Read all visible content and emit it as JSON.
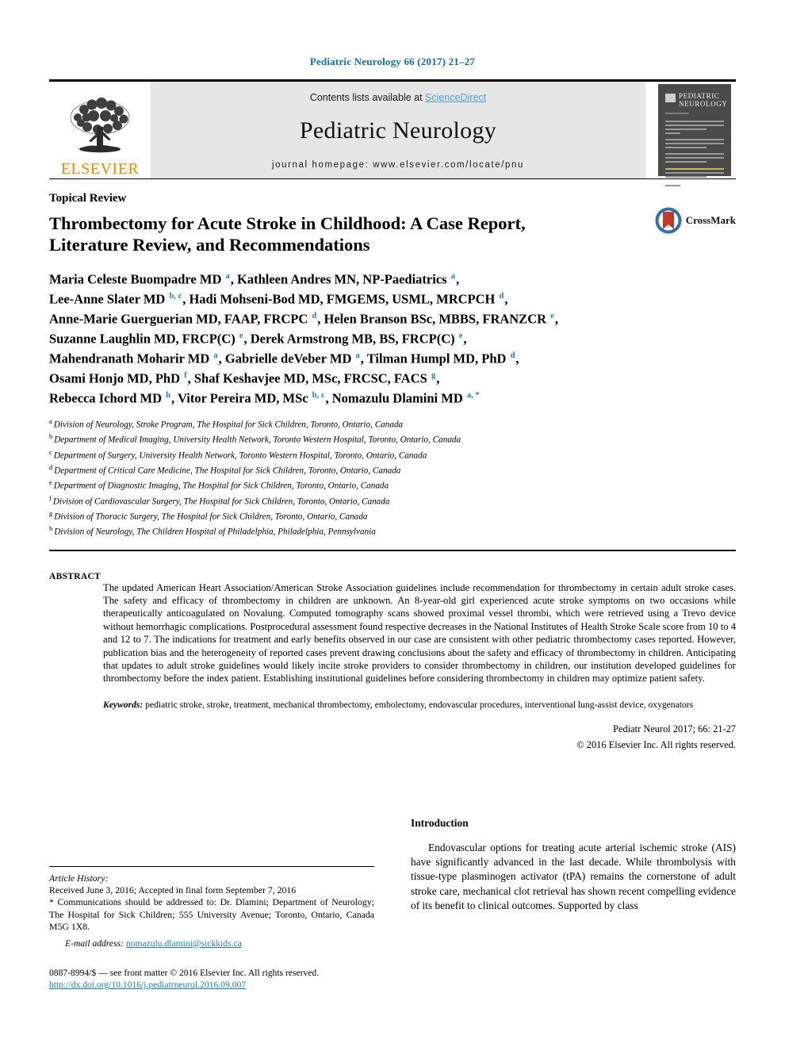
{
  "running_head": "Pediatric Neurology 66 (2017) 21–27",
  "masthead": {
    "publisher_name": "ELSEVIER",
    "contents_prefix": "Contents lists available at ",
    "contents_link": "ScienceDirect",
    "journal_name": "Pediatric Neurology",
    "homepage_line": "journal homepage: www.elsevier.com/locate/pnu",
    "cover_title_line1": "PEDIATRIC",
    "cover_title_line2": "NEUROLOGY"
  },
  "article": {
    "kicker": "Topical Review",
    "title": "Thrombectomy for Acute Stroke in Childhood: A Case Report, Literature Review, and Recommendations",
    "crossmark_label": "CrossMark"
  },
  "authors_html": "Maria Celeste Buompadre MD <sup>a</sup>, Kathleen Andres MN, NP-Paediatrics <sup>a</sup>,<br>Lee-Anne Slater MD <sup>b, c</sup>, Hadi Mohseni-Bod MD, FMGEMS, USML, MRCPCH <sup>d</sup>,<br>Anne-Marie Guerguerian MD, FAAP, FRCPC <sup>d</sup>, Helen Branson BSc, MBBS, FRANZCR <sup>e</sup>,<br>Suzanne Laughlin MD, FRCP(C) <sup>e</sup>, Derek Armstrong MB, BS, FRCP(C) <sup>e</sup>,<br>Mahendranath Moharir MD <sup>a</sup>, Gabrielle deVeber MD <sup>a</sup>, Tilman Humpl MD, PhD <sup>d</sup>,<br>Osami Honjo MD, PhD <sup>f</sup>, Shaf Keshavjee MD, MSc, FRCSC, FACS <sup>g</sup>,<br>Rebecca Ichord MD <sup>h</sup>, Vitor Pereira MD, MSc <sup>b, c</sup>, Nomazulu Dlamini MD <sup>a, *</sup>",
  "affiliations": [
    {
      "mark": "a",
      "text": "Division of Neurology, Stroke Program, The Hospital for Sick Children, Toronto, Ontario, Canada"
    },
    {
      "mark": "b",
      "text": "Department of Medical Imaging, University Health Network, Toronto Western Hospital, Toronto, Ontario, Canada"
    },
    {
      "mark": "c",
      "text": "Department of Surgery, University Health Network, Toronto Western Hospital, Toronto, Ontario, Canada"
    },
    {
      "mark": "d",
      "text": "Department of Critical Care Medicine, The Hospital for Sick Children, Toronto, Ontario, Canada"
    },
    {
      "mark": "e",
      "text": "Department of Diagnostic Imaging, The Hospital for Sick Children, Toronto, Ontario, Canada"
    },
    {
      "mark": "f",
      "text": "Division of Cardiovascular Surgery, The Hospital for Sick Children, Toronto, Ontario, Canada"
    },
    {
      "mark": "g",
      "text": "Division of Thoracic Surgery, The Hospital for Sick Children, Toronto, Ontario, Canada"
    },
    {
      "mark": "h",
      "text": "Division of Neurology, The Children Hospital of Philadelphia, Philadelphia, Pennsylvania"
    }
  ],
  "abstract": {
    "label": "ABSTRACT",
    "text": "The updated American Heart Association/American Stroke Association guidelines include recommendation for thrombectomy in certain adult stroke cases. The safety and efficacy of thrombectomy in children are unknown. An 8-year-old girl experienced acute stroke symptoms on two occasions while therapeutically anticoagulated on Novalung. Computed tomography scans showed proximal vessel thrombi, which were retrieved using a Trevo device without hemorrhagic complications. Postprocedural assessment found respective decreases in the National Institutes of Health Stroke Scale score from 10 to 4 and 12 to 7. The indications for treatment and early benefits observed in our case are consistent with other pediatric thrombectomy cases reported. However, publication bias and the heterogeneity of reported cases prevent drawing conclusions about the safety and efficacy of thrombectomy in children. Anticipating that updates to adult stroke guidelines would likely incite stroke providers to consider thrombectomy in children, our institution developed guidelines for thrombectomy before the index patient. Establishing institutional guidelines before considering thrombectomy in children may optimize patient safety.",
    "keywords_label": "Keywords:",
    "keywords": "pediatric stroke, stroke, treatment, mechanical thrombectomy, embolectomy, endovascular procedures, interventional lung-assist device, oxygenators",
    "citation": "Pediatr Neurol 2017; 66: 21-27",
    "rights": "© 2016 Elsevier Inc. All rights reserved."
  },
  "article_history": {
    "label": "Article History:",
    "dates": "Received June 3, 2016; Accepted in final form September 7, 2016",
    "correspondence": "* Communications should be addressed to: Dr. Dlamini; Department of Neurology; The Hospital for Sick Children; 555 University Avenue; Toronto, Ontario, Canada M5G 1X8.",
    "email_label": "E-mail address:",
    "email": "nomazulu.dlamini@sickkids.ca"
  },
  "footer": {
    "issn_line": "0887-8994/$ — see front matter © 2016 Elsevier Inc. All rights reserved.",
    "doi": "http://dx.doi.org/10.1016/j.pediatrneurol.2016.09.007"
  },
  "introduction": {
    "heading": "Introduction",
    "text": "Endovascular options for treating acute arterial ischemic stroke (AIS) have significantly advanced in the last decade. While thrombolysis with tissue-type plasminogen activator (tPA) remains the cornerstone of adult stroke care, mechanical clot retrieval has shown recent compelling evidence of its benefit to clinical outcomes. Supported by class"
  },
  "colors": {
    "running_head": "#1a6aa5",
    "link": "#1a7fb5",
    "sciencedirect": "#4da3d6",
    "elsevier_orange": "#F08C00",
    "masthead_bg": "#e6e6e6",
    "cover_bg": "#4a4a4a",
    "crossmark_blue": "#2f6fb0",
    "crossmark_red": "#c0392b"
  }
}
